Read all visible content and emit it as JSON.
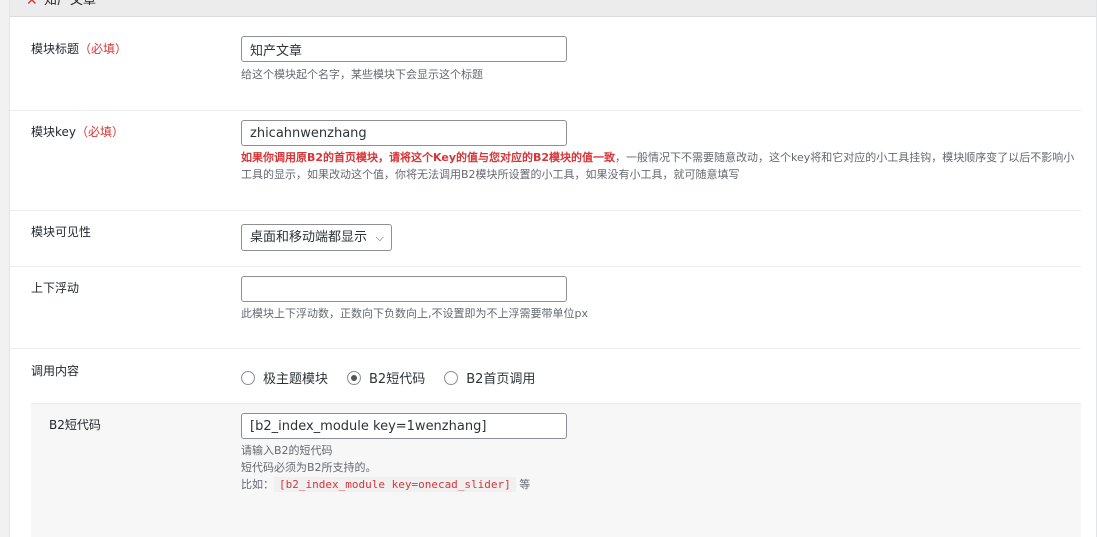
{
  "panel": {
    "title": "知产文章",
    "close_glyph": "✕",
    "collapse_glyph": "–"
  },
  "fields": {
    "module_title": {
      "label": "模块标题",
      "required": "（必填）",
      "value": "知产文章",
      "desc": "给这个模块起个名字，某些模块下会显示这个标题"
    },
    "module_key": {
      "label": "模块key",
      "required": "（必填）",
      "value": "zhicahnwenzhang",
      "desc_warn": "如果你调用原B2的首页模块，请将这个Key的值与您对应的B2模块的值一致",
      "desc_rest": "，一般情况下不需要随意改动，这个key将和它对应的小工具挂钩，模块顺序变了以后不影响小工具的显示，如果改动这个值，你将无法调用B2模块所设置的小工具，如果没有小工具，就可随意填写"
    },
    "visibility": {
      "label": "模块可见性",
      "selected": "桌面和移动端都显示"
    },
    "float": {
      "label": "上下浮动",
      "value": "",
      "desc": "此模块上下浮动数，正数向下负数向上,不设置即为不上浮需要带单位px"
    },
    "content": {
      "label": "调用内容",
      "options": [
        "极主题模块",
        "B2短代码",
        "B2首页调用"
      ],
      "selected": "B2短代码"
    },
    "shortcode": {
      "label": "B2短代码",
      "value": "[b2_index_module key=1wenzhang]",
      "desc_line1": "请输入B2的短代码",
      "desc_line2": "短代码必须为B2所支持的。",
      "example_prefix": "比如：",
      "example_code": "[b2_index_module key=onecad_slider]",
      "example_suffix": "等"
    }
  }
}
